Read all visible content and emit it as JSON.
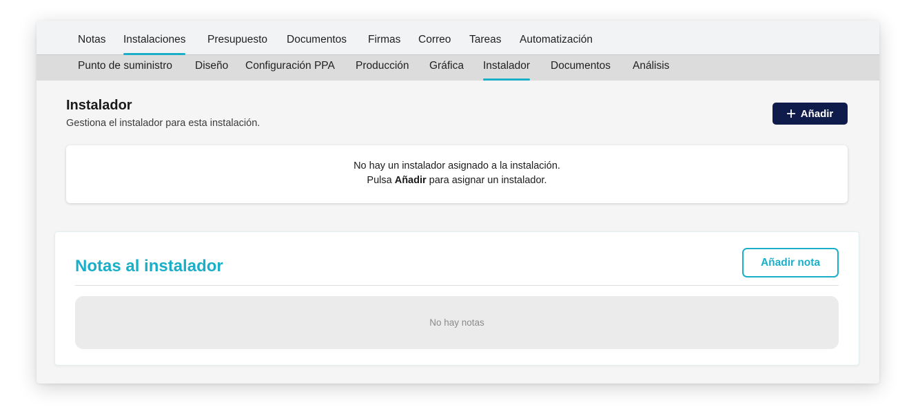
{
  "main_tabs": [
    {
      "label": "Notas",
      "active": false
    },
    {
      "label": "Instalaciones",
      "active": true
    },
    {
      "label": "Presupuesto",
      "active": false
    },
    {
      "label": "Documentos",
      "active": false
    },
    {
      "label": "Firmas",
      "active": false
    },
    {
      "label": "Correo",
      "active": false
    },
    {
      "label": "Tareas",
      "active": false
    },
    {
      "label": "Automatización",
      "active": false
    }
  ],
  "sub_tabs": [
    {
      "label": "Punto de suministro",
      "active": false
    },
    {
      "label": "Diseño",
      "active": false
    },
    {
      "label": "Configuración PPA",
      "active": false
    },
    {
      "label": "Producción",
      "active": false
    },
    {
      "label": "Gráfica",
      "active": false
    },
    {
      "label": "Instalador",
      "active": true
    },
    {
      "label": "Documentos",
      "active": false
    },
    {
      "label": "Análisis",
      "active": false
    }
  ],
  "installer": {
    "title": "Instalador",
    "subtitle": "Gestiona el instalador para esta instalación.",
    "add_button_icon": "plus-icon",
    "add_button_label": "Añadir",
    "empty_line1": "No hay un instalador asignado a la instalación.",
    "empty_line2_prefix": "Pulsa",
    "empty_line2_bold": "Añadir",
    "empty_line2_suffix": "para asignar un instalador."
  },
  "notes": {
    "title": "Notas al instalador",
    "add_note_label": "Añadir nota",
    "empty_text": "No hay notas"
  },
  "colors": {
    "accent": "#1aaec8",
    "primary_button": "#0f1b4a",
    "tab_bar": "#f2f3f4",
    "subtab_bar": "#dcdcdc"
  }
}
